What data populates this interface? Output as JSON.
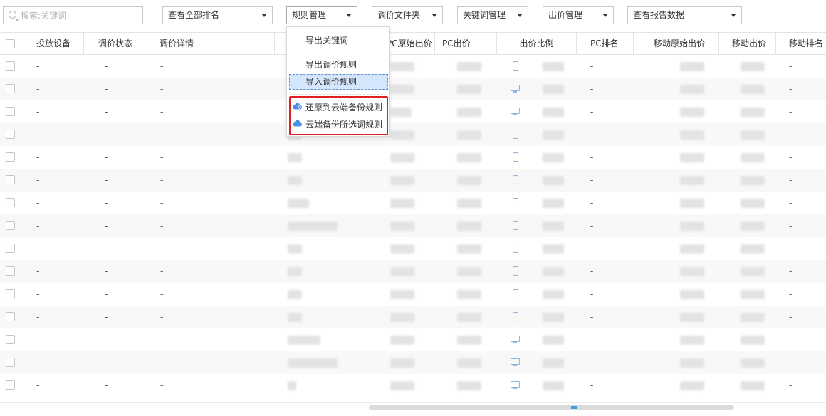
{
  "toolbar": {
    "search_placeholder": "搜索:关键词",
    "rank_view": "查看全部排名",
    "rule_mgmt": "规则管理",
    "bid_folder": "调价文件夹",
    "keyword_mgmt": "关键词管理",
    "bid_mgmt": "出价管理",
    "report_view": "查看报告数据"
  },
  "menu": {
    "items": [
      {
        "label": "导出关键词"
      },
      {
        "label": "导出调价规则"
      },
      {
        "label": "导入调价规则"
      },
      {
        "label": "还原到云端备份规则",
        "icon": "cloud-restore-icon"
      },
      {
        "label": "云端备份所选词规则",
        "icon": "cloud-backup-icon"
      }
    ],
    "highlighted_item": "导入调价规则",
    "accent_color": "#e02020"
  },
  "table": {
    "columns": [
      "投放设备",
      "调价状态",
      "调价详情",
      "",
      "PC原始出价",
      "PC出价",
      "出价比例",
      "PC排名",
      "移动原始出价",
      "移动出价",
      "移动排名"
    ],
    "rows": [
      {
        "device_cell": "-",
        "status": "-",
        "detail": "-",
        "pc_rank": "-",
        "mobile_rank": "-",
        "device": "mobile"
      },
      {
        "device_cell": "-",
        "status": "-",
        "detail": "-",
        "pc_rank": "-",
        "mobile_rank": "-",
        "device": "pc"
      },
      {
        "device_cell": "-",
        "status": "-",
        "detail": "-",
        "pc_rank": "-",
        "mobile_rank": "-",
        "device": "pc"
      },
      {
        "device_cell": "-",
        "status": "-",
        "detail": "-",
        "pc_rank": "-",
        "mobile_rank": "-",
        "device": "mobile"
      },
      {
        "device_cell": "-",
        "status": "-",
        "detail": "-",
        "pc_rank": "-",
        "mobile_rank": "-",
        "device": "mobile"
      },
      {
        "device_cell": "-",
        "status": "-",
        "detail": "-",
        "pc_rank": "-",
        "mobile_rank": "-",
        "device": "mobile"
      },
      {
        "device_cell": "-",
        "status": "-",
        "detail": "-",
        "pc_rank": "-",
        "mobile_rank": "-",
        "device": "mobile"
      },
      {
        "device_cell": "-",
        "status": "-",
        "detail": "-",
        "pc_rank": "-",
        "mobile_rank": "-",
        "device": "mobile"
      },
      {
        "device_cell": "-",
        "status": "-",
        "detail": "-",
        "pc_rank": "-",
        "mobile_rank": "-",
        "device": "mobile"
      },
      {
        "device_cell": "-",
        "status": "-",
        "detail": "-",
        "pc_rank": "-",
        "mobile_rank": "-",
        "device": "mobile"
      },
      {
        "device_cell": "-",
        "status": "-",
        "detail": "-",
        "pc_rank": "-",
        "mobile_rank": "-",
        "device": "mobile"
      },
      {
        "device_cell": "-",
        "status": "-",
        "detail": "-",
        "pc_rank": "-",
        "mobile_rank": "-",
        "device": "mobile"
      },
      {
        "device_cell": "-",
        "status": "-",
        "detail": "-",
        "pc_rank": "-",
        "mobile_rank": "-",
        "device": "pc"
      },
      {
        "device_cell": "-",
        "status": "-",
        "detail": "-",
        "pc_rank": "-",
        "mobile_rank": "-",
        "device": "pc"
      },
      {
        "device_cell": "-",
        "status": "-",
        "detail": "-",
        "pc_rank": "-",
        "mobile_rank": "-",
        "device": "pc"
      }
    ]
  }
}
